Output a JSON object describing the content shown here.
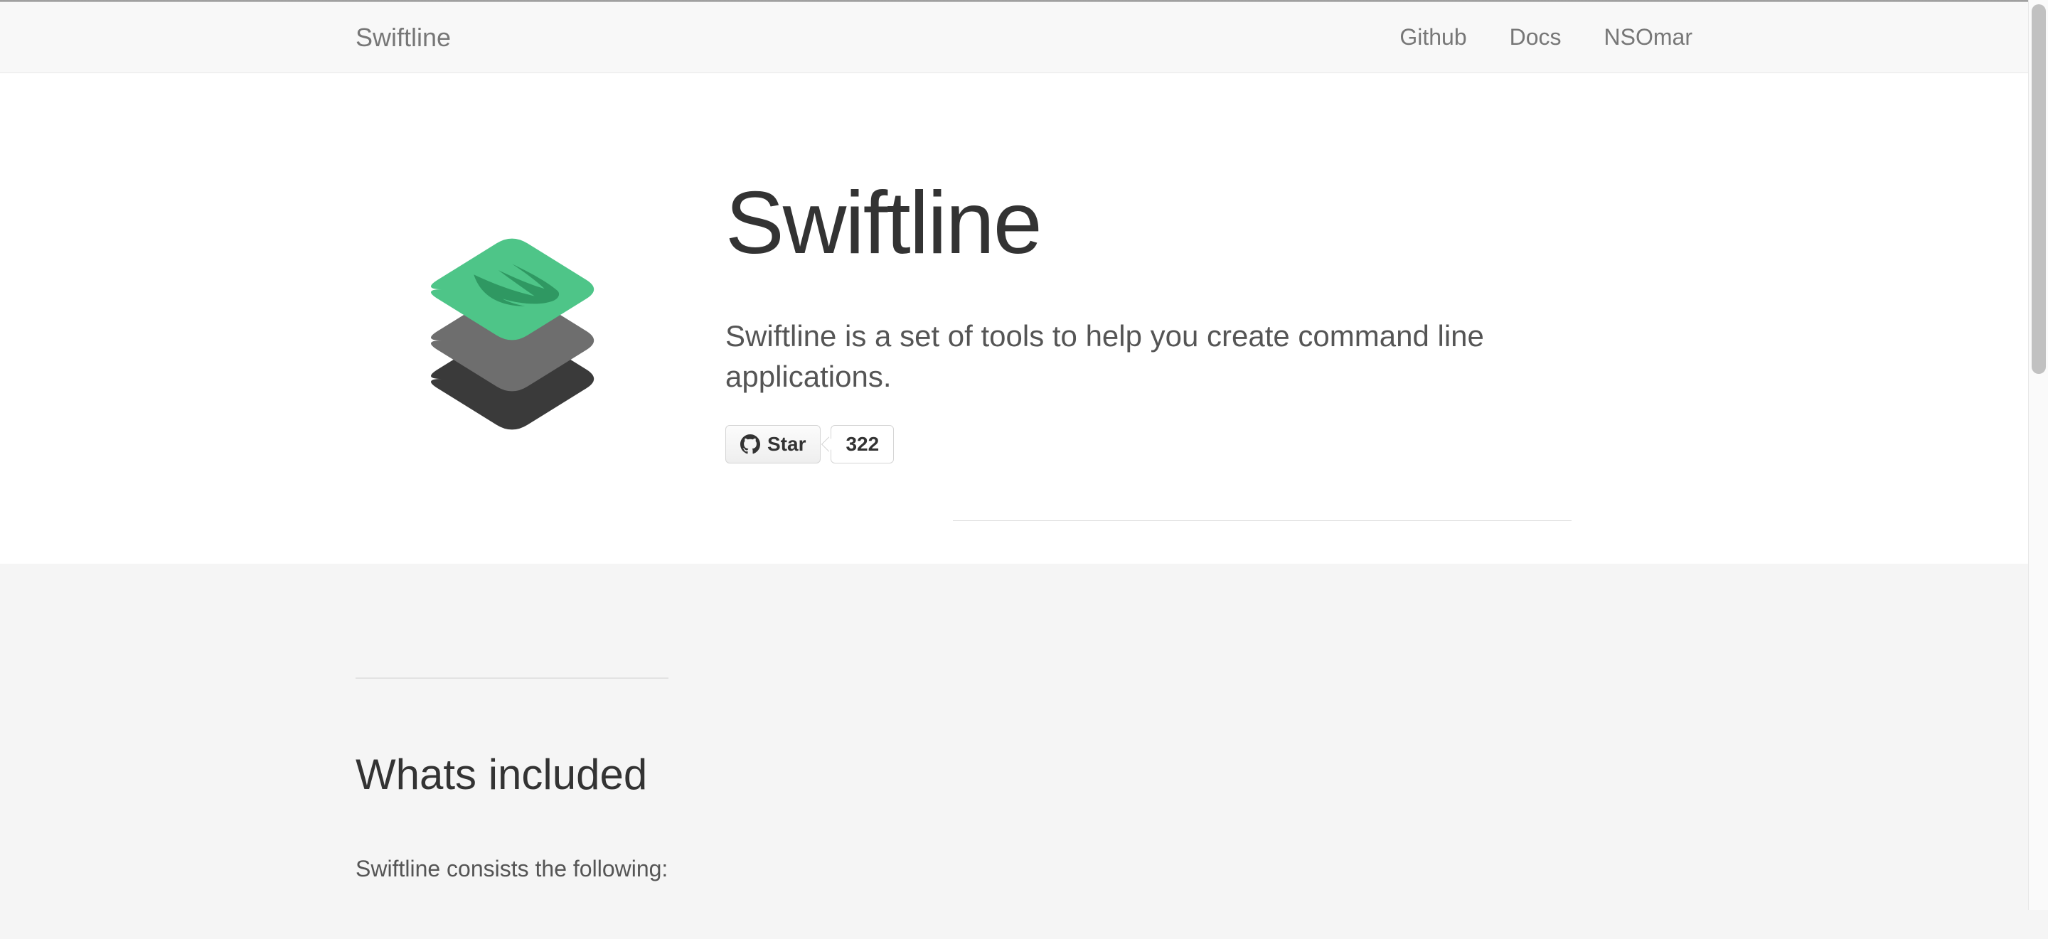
{
  "nav": {
    "brand": "Swiftline",
    "links": [
      {
        "label": "Github"
      },
      {
        "label": "Docs"
      },
      {
        "label": "NSOmar"
      }
    ]
  },
  "hero": {
    "title": "Swiftline",
    "subtitle": "Swiftline is a set of tools to help you create command line applications.",
    "star_label": "Star",
    "star_count": "322"
  },
  "section": {
    "heading": "Whats included",
    "intro": "Swiftline consists the following:"
  },
  "icons": {
    "github": "github-icon",
    "swift": "swift-logo-icon"
  }
}
